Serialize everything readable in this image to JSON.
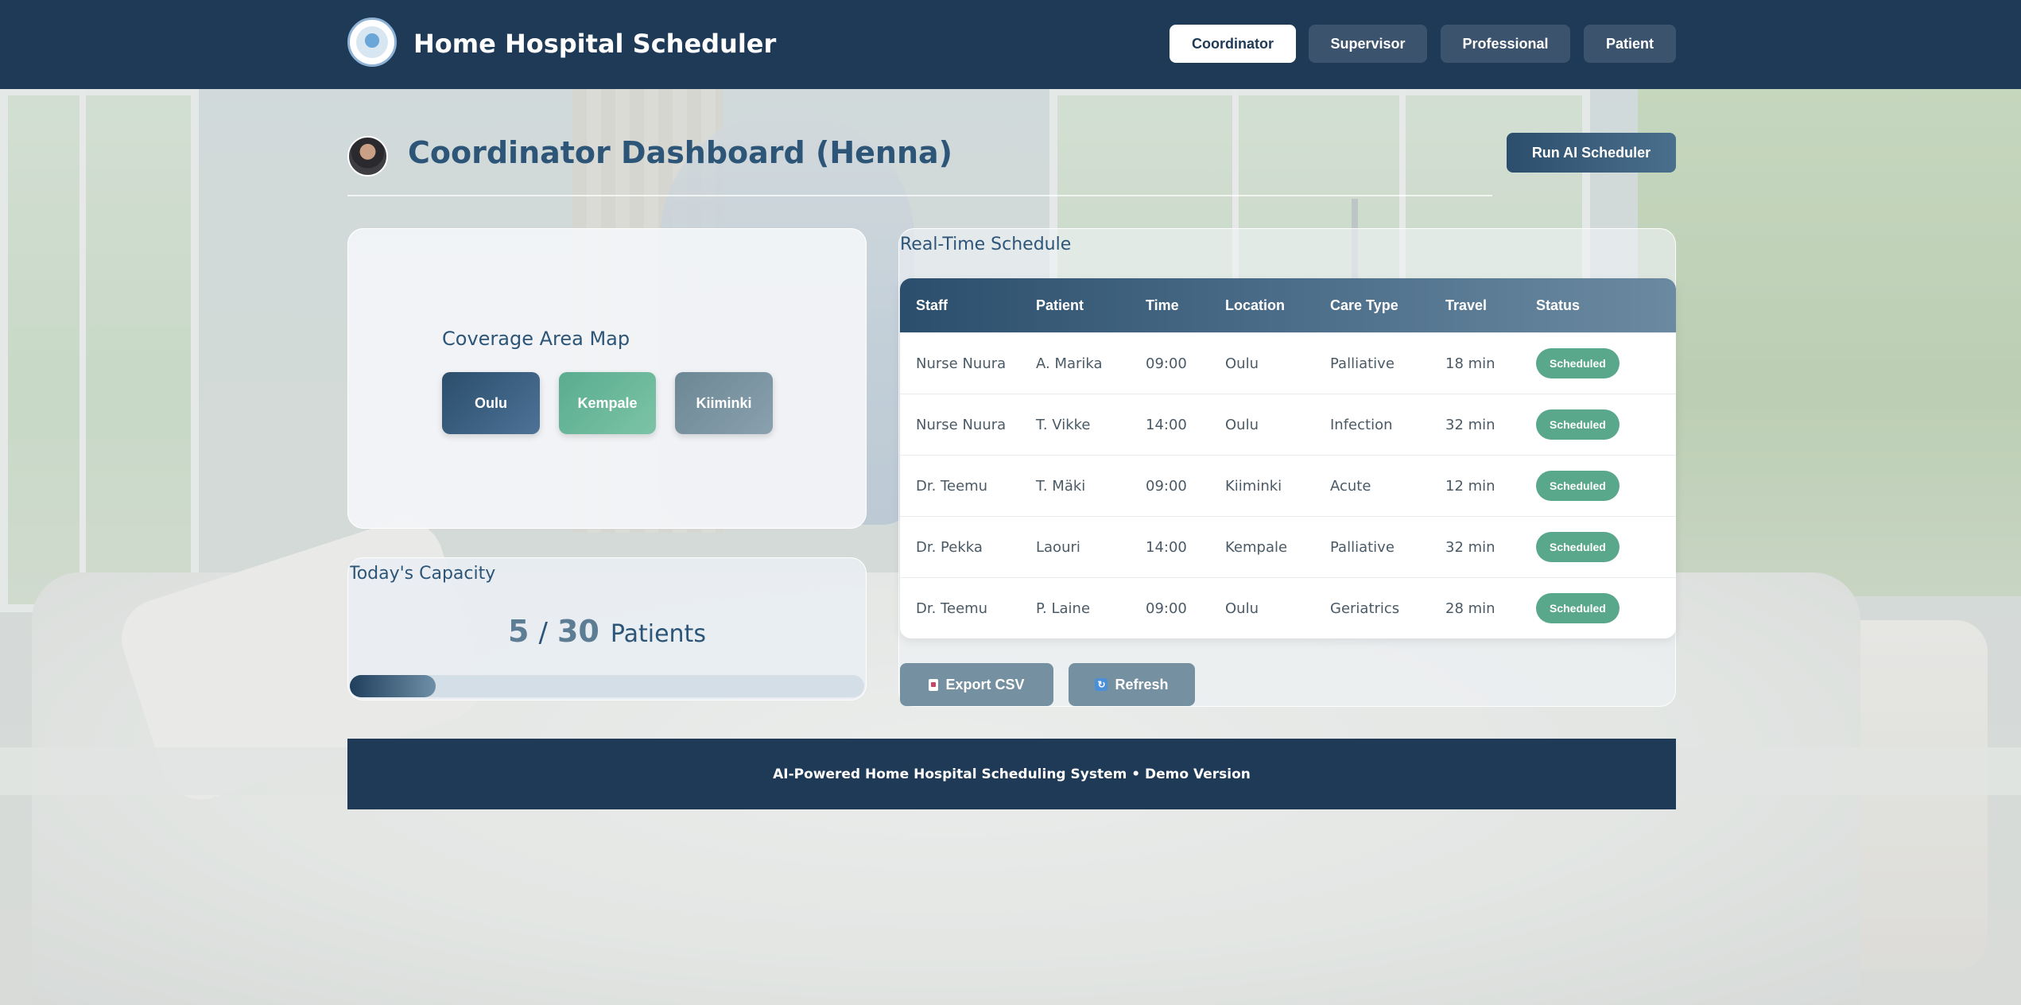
{
  "header": {
    "app_title": "Home Hospital Scheduler",
    "logo_icon": "hospital-logo-icon",
    "nav": [
      {
        "label": "Coordinator",
        "active": true
      },
      {
        "label": "Supervisor",
        "active": false
      },
      {
        "label": "Professional",
        "active": false
      },
      {
        "label": "Patient",
        "active": false
      }
    ]
  },
  "dashboard": {
    "title": "Coordinator Dashboard (Henna)",
    "run_button": "Run AI Scheduler"
  },
  "map": {
    "title": "Coverage Area Map",
    "zones": [
      "Oulu",
      "Kempale",
      "Kiiminki"
    ]
  },
  "capacity": {
    "title": "Today's Capacity",
    "current": "5",
    "separator": "/",
    "total": "30",
    "unit": "Patients",
    "fill_fraction": 0.1667
  },
  "schedule": {
    "title": "Real-Time Schedule",
    "columns": [
      "Staff",
      "Patient",
      "Time",
      "Location",
      "Care Type",
      "Travel",
      "Status"
    ],
    "rows": [
      [
        "Nurse Nuura",
        "A. Marika",
        "09:00",
        "Oulu",
        "Palliative",
        "18 min",
        "Scheduled"
      ],
      [
        "Nurse Nuura",
        "T. Vikke",
        "14:00",
        "Oulu",
        "Infection",
        "32 min",
        "Scheduled"
      ],
      [
        "Dr. Teemu",
        "T. Mäki",
        "09:00",
        "Kiiminki",
        "Acute",
        "12 min",
        "Scheduled"
      ],
      [
        "Dr. Pekka",
        "Laouri",
        "14:00",
        "Kempale",
        "Palliative",
        "32 min",
        "Scheduled"
      ],
      [
        "Dr. Teemu",
        "P. Laine",
        "09:00",
        "Oulu",
        "Geriatrics",
        "28 min",
        "Scheduled"
      ]
    ],
    "export_button": "Export CSV",
    "refresh_button": "Refresh"
  },
  "footer": {
    "text": "AI-Powered Home Hospital Scheduling System • Demo Version"
  },
  "colors": {
    "header": "#1e3a56",
    "accent": "#2d5577",
    "status_scheduled": "#5aa88c",
    "zone_oulu": "#2b4e6c",
    "zone_kempale": "#5aad90",
    "zone_kiiminki": "#6c8795"
  }
}
